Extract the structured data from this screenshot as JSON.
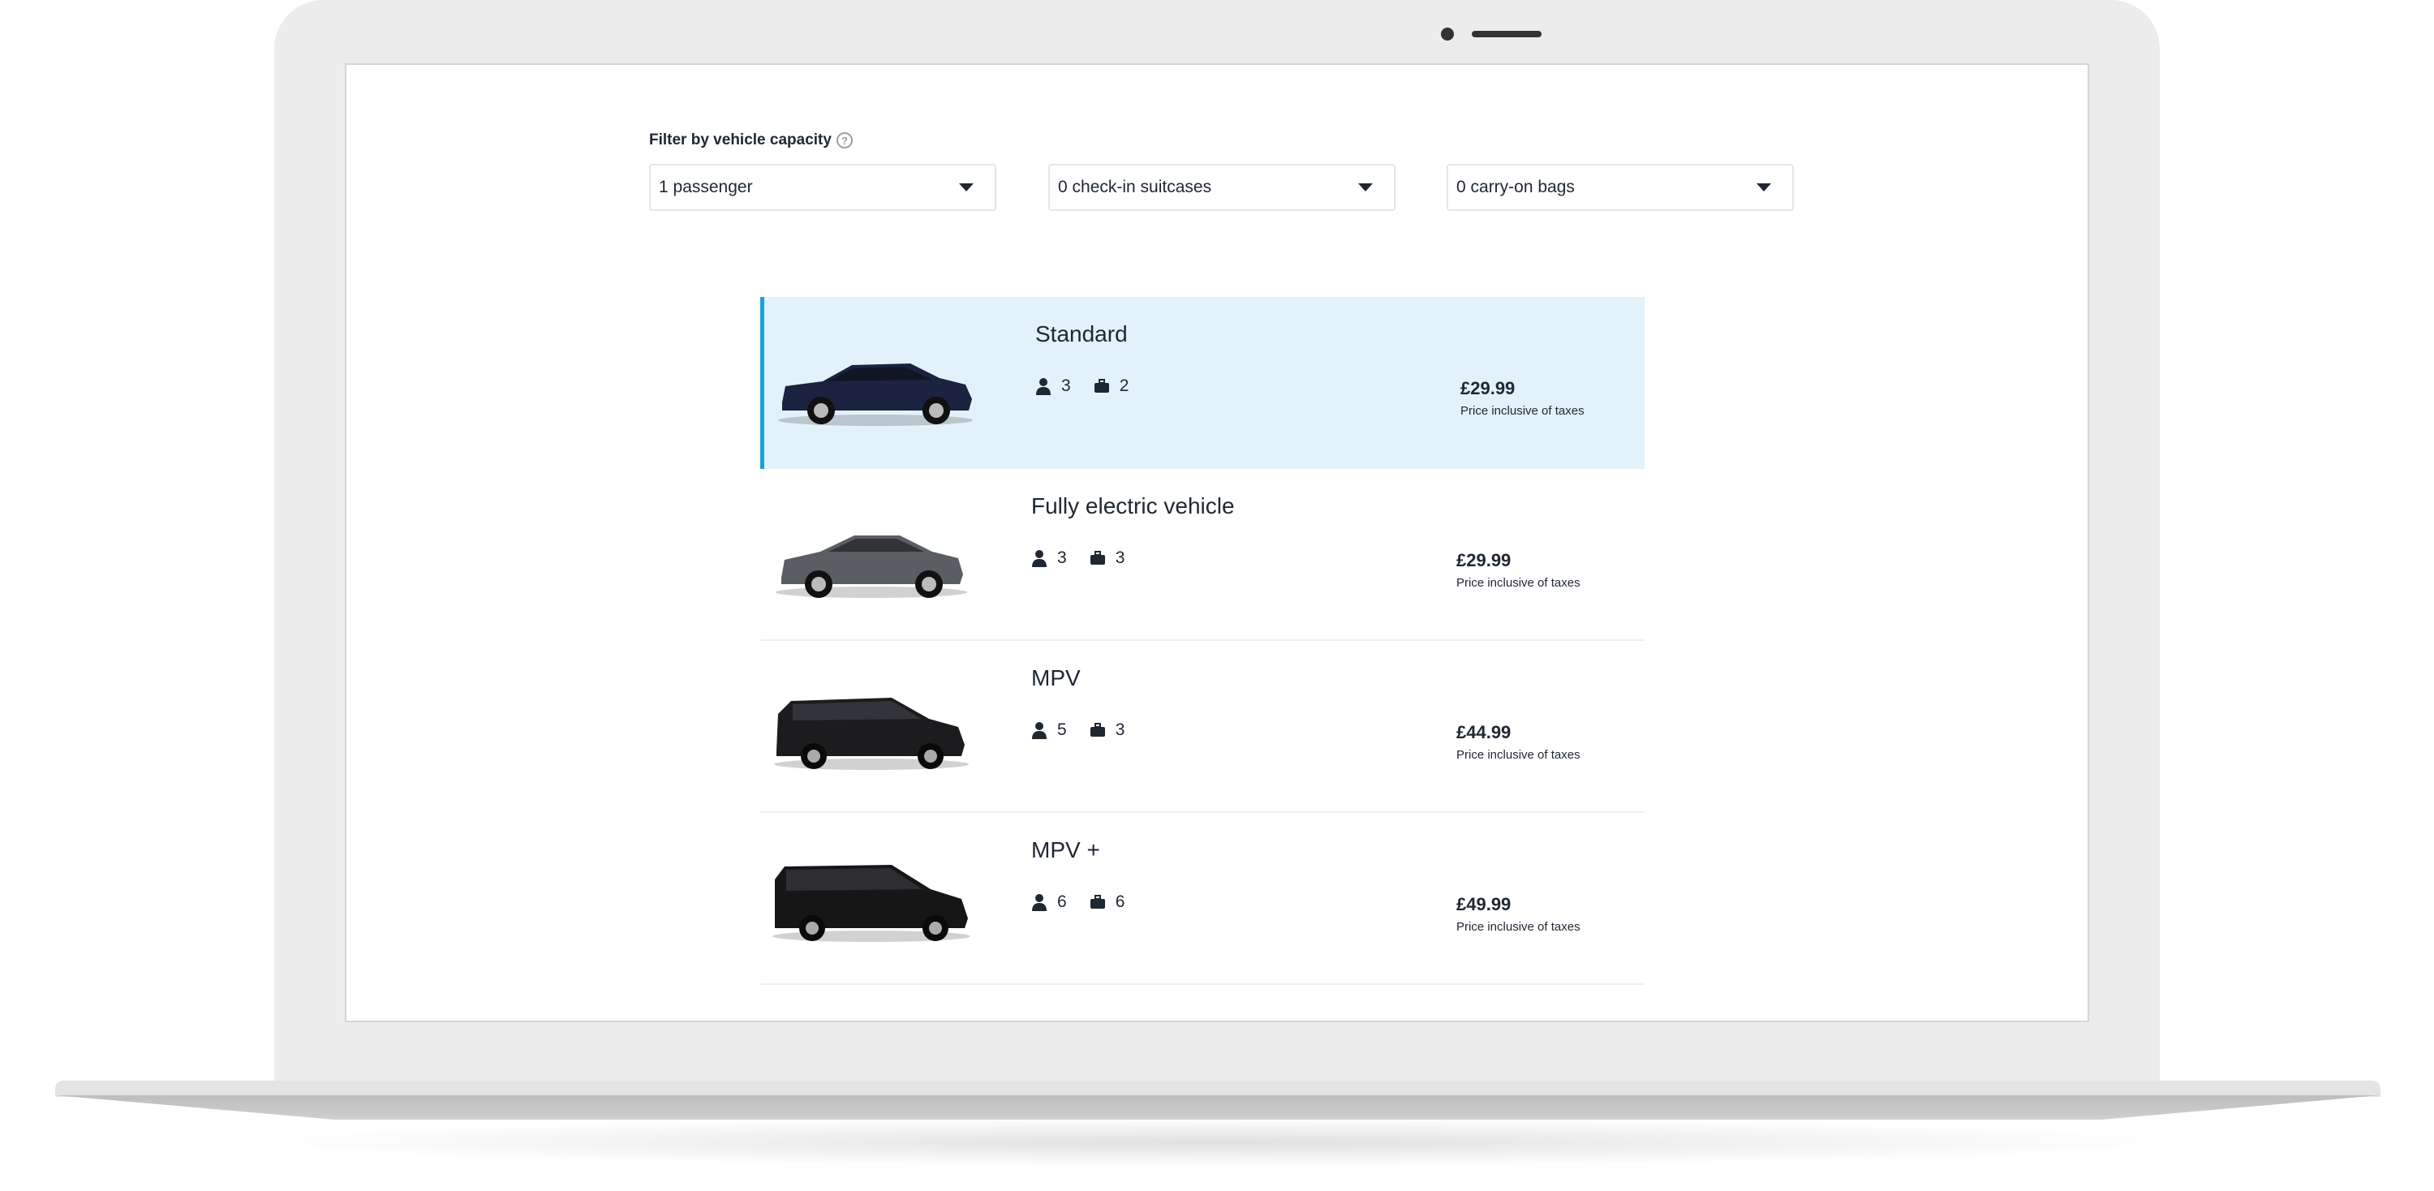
{
  "filter": {
    "label": "Filter by vehicle capacity",
    "help_icon": "question-circle-icon",
    "passengers": "1 passenger",
    "suitcases": "0 check-in suitcases",
    "carry_on": "0 carry-on bags"
  },
  "vehicles": [
    {
      "name": "Standard",
      "passengers": "3",
      "luggage": "2",
      "price": "£29.99",
      "price_note": "Price inclusive of taxes",
      "selected": true,
      "color": "#1b2340"
    },
    {
      "name": "Fully electric vehicle",
      "passengers": "3",
      "luggage": "3",
      "price": "£29.99",
      "price_note": "Price inclusive of taxes",
      "selected": false,
      "color": "#5a5d62"
    },
    {
      "name": "MPV",
      "passengers": "5",
      "luggage": "3",
      "price": "£44.99",
      "price_note": "Price inclusive of taxes",
      "selected": false,
      "color": "#1c1c1e"
    },
    {
      "name": "MPV +",
      "passengers": "6",
      "luggage": "6",
      "price": "£49.99",
      "price_note": "Price inclusive of taxes",
      "selected": false,
      "color": "#161617"
    }
  ],
  "colors": {
    "accent": "#1aa0d8",
    "selected_bg": "#e3f1fa",
    "text": "#1f2733"
  },
  "icons": {
    "passenger": "person-icon",
    "luggage": "suitcase-icon",
    "dropdown": "caret-down-icon"
  }
}
